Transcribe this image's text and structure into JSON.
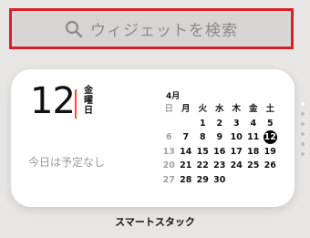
{
  "search": {
    "placeholder": "ウィジェットを検索",
    "icon": "search-icon",
    "highlight_color": "#d81f2a"
  },
  "widget": {
    "day_number": "12",
    "weekday_chars": [
      "金",
      "曜",
      "日"
    ],
    "no_events": "今日は予定なし",
    "month": "4月",
    "weekday_headers": [
      "日",
      "月",
      "火",
      "水",
      "木",
      "金",
      "土"
    ],
    "weeks": [
      [
        "",
        "",
        "1",
        "2",
        "3",
        "4",
        "5"
      ],
      [
        "6",
        "7",
        "8",
        "9",
        "10",
        "11",
        "12"
      ],
      [
        "13",
        "14",
        "15",
        "16",
        "17",
        "18",
        "19"
      ],
      [
        "20",
        "21",
        "22",
        "23",
        "24",
        "25",
        "26"
      ],
      [
        "27",
        "28",
        "29",
        "30",
        "",
        "",
        ""
      ]
    ],
    "today": "12",
    "accent_color": "#ff4b2b"
  },
  "pager": {
    "count": 6,
    "active_index": 0
  },
  "stack_label": "スマートスタック"
}
